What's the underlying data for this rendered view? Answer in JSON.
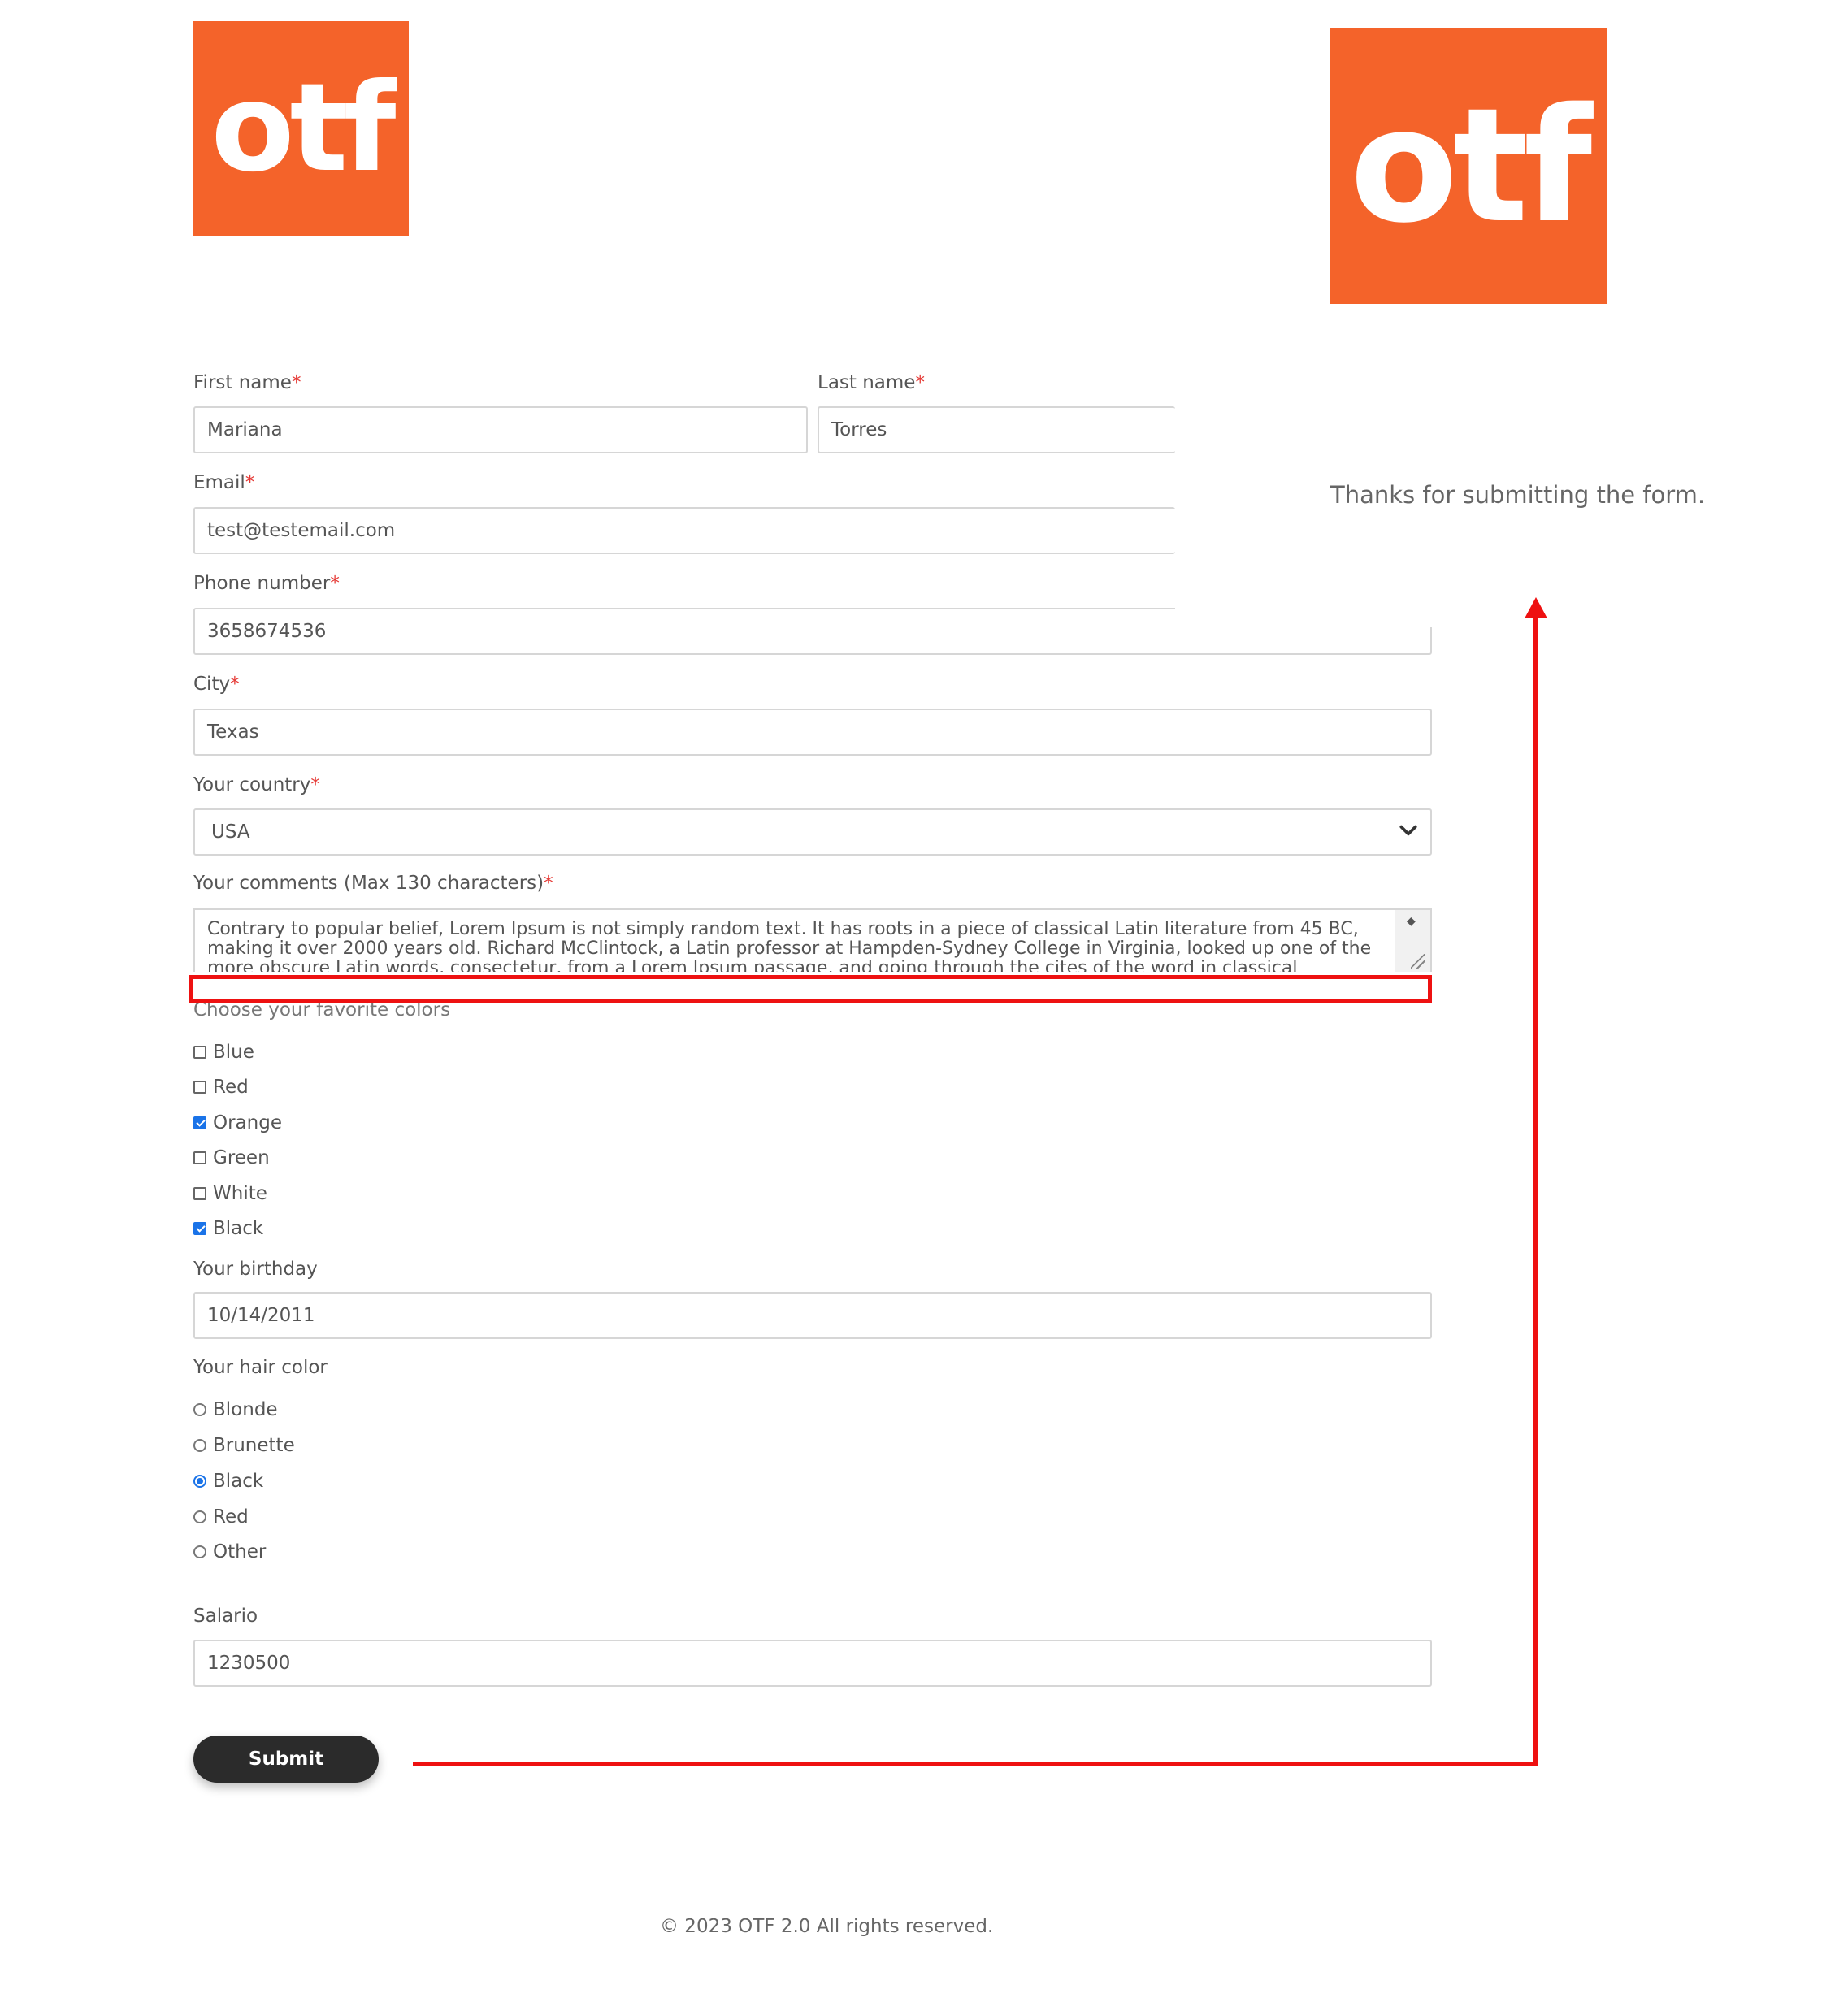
{
  "logo": {
    "text": "otf",
    "brand_color": "#f4632a"
  },
  "confirmation": {
    "message": "Thanks for submitting the form."
  },
  "form": {
    "first_name": {
      "label": "First name",
      "value": "Mariana"
    },
    "last_name": {
      "label": "Last name",
      "value": "Torres"
    },
    "email": {
      "label": "Email",
      "value": "test@testemail.com"
    },
    "phone": {
      "label": "Phone number",
      "value": "3658674536"
    },
    "city": {
      "label": "City",
      "value": "Texas"
    },
    "country": {
      "label": "Your country",
      "value": "USA"
    },
    "comments": {
      "label": "Your comments (Max 130 characters)",
      "value": "Contrary to popular belief, Lorem Ipsum is not simply random text. It has roots in a piece of classical Latin literature from 45 BC, making it over 2000 years old. Richard McClintock, a Latin professor at Hampden-Sydney College in Virginia, looked up one of the more obscure Latin words, consectetur, from a Lorem Ipsum passage, and going through the cites of the word in classical literature"
    },
    "colors": {
      "label": "Choose your favorite colors",
      "options": [
        {
          "label": "Blue",
          "checked": false
        },
        {
          "label": "Red",
          "checked": false
        },
        {
          "label": "Orange",
          "checked": true
        },
        {
          "label": "Green",
          "checked": false
        },
        {
          "label": "White",
          "checked": false
        },
        {
          "label": "Black",
          "checked": true
        }
      ]
    },
    "birthday": {
      "label": "Your birthday",
      "value": "10/14/2011"
    },
    "hair": {
      "label": "Your hair color",
      "options": [
        {
          "label": "Blonde",
          "selected": false
        },
        {
          "label": "Brunette",
          "selected": false
        },
        {
          "label": "Black",
          "selected": true
        },
        {
          "label": "Red",
          "selected": false
        },
        {
          "label": "Other",
          "selected": false
        }
      ]
    },
    "salary": {
      "label": "Salario",
      "value": "1230500"
    },
    "required_mark": "*",
    "submit_label": "Submit"
  },
  "footer": {
    "text": "© 2023 OTF 2.0 All rights reserved."
  },
  "annotation": {
    "color": "#ee1111"
  }
}
